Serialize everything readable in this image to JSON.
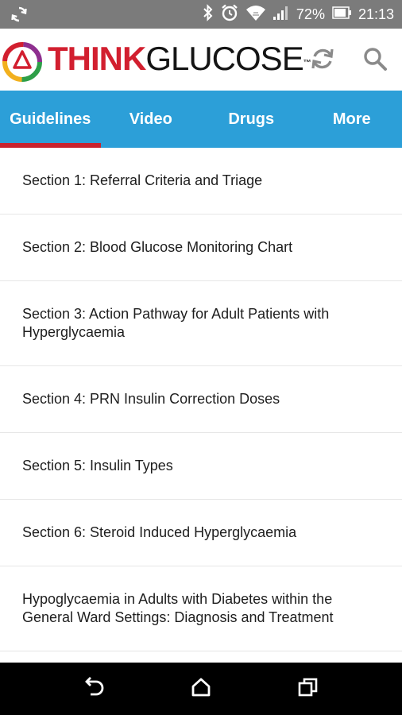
{
  "status_bar": {
    "battery": "72%",
    "time": "21:13",
    "icons": [
      "sync-icon",
      "bluetooth-icon",
      "alarm-icon",
      "wifi-icon",
      "signal-icon",
      "battery-icon"
    ]
  },
  "header": {
    "brand_think": "THINK",
    "brand_glucose": "GLUCOSE",
    "brand_tm": "™",
    "colors": {
      "brand_red": "#d21f2f",
      "tab_blue": "#2c9fd8",
      "tab_underline": "#c8232d"
    },
    "actions": [
      "refresh-icon",
      "search-icon"
    ]
  },
  "tabs": [
    {
      "label": "Guidelines",
      "active": true
    },
    {
      "label": "Video",
      "active": false
    },
    {
      "label": "Drugs",
      "active": false
    },
    {
      "label": "More",
      "active": false
    }
  ],
  "sections": [
    {
      "label": "Section 1: Referral Criteria and Triage"
    },
    {
      "label": "Section 2: Blood Glucose Monitoring Chart"
    },
    {
      "label": "Section 3: Action Pathway for Adult Patients with Hyperglycaemia"
    },
    {
      "label": "Section 4: PRN Insulin Correction Doses"
    },
    {
      "label": "Section 5: Insulin Types"
    },
    {
      "label": "Section 6: Steroid Induced Hyperglycaemia"
    },
    {
      "label": "Hypoglycaemia in Adults with Diabetes within the General Ward Settings: Diagnosis and Treatment"
    }
  ],
  "nav": [
    "back-icon",
    "home-icon",
    "recents-icon"
  ]
}
